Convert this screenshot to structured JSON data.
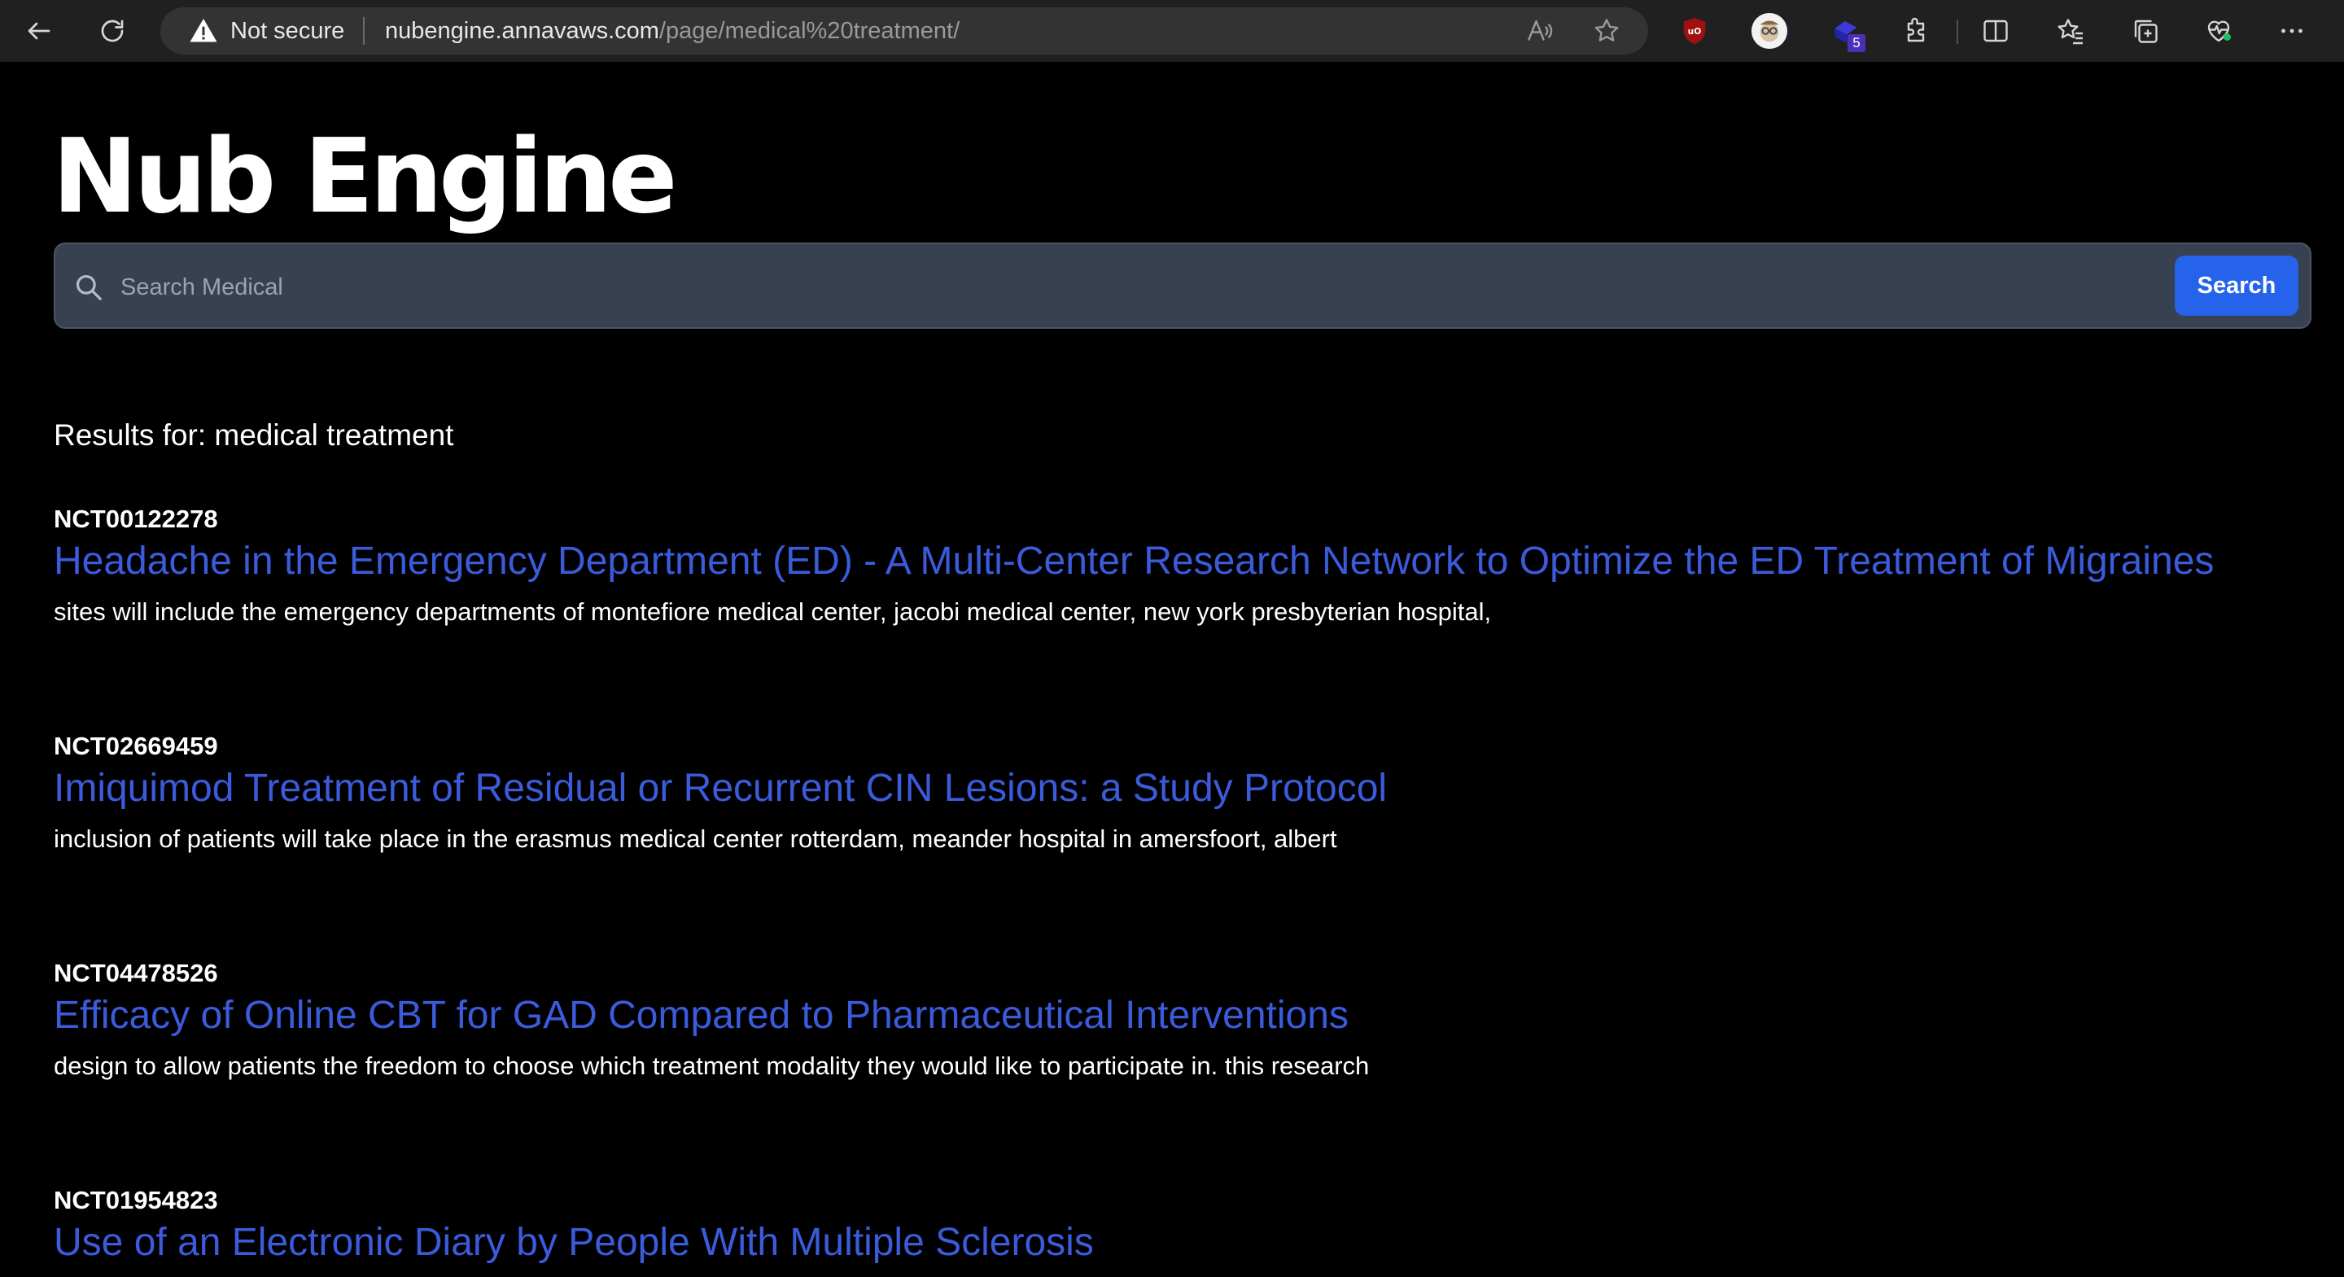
{
  "browser": {
    "security_label": "Not secure",
    "url_host": "nubengine.annavaws.com",
    "url_path": "/page/medical%20treatment/",
    "extension_badge": "5"
  },
  "site": {
    "title": "Nub Engine"
  },
  "search": {
    "placeholder": "Search Medical",
    "value": "",
    "button_label": "Search"
  },
  "results_heading": "Results for: medical treatment",
  "results": [
    {
      "id": "NCT00122278",
      "title": "Headache in the Emergency Department (ED) - A Multi-Center Research Network to Optimize the ED Treatment of Migraines",
      "snippet": "sites will include the emergency departments of montefiore medical center, jacobi medical center, new york presbyterian hospital,"
    },
    {
      "id": "NCT02669459",
      "title": "Imiquimod Treatment of Residual or Recurrent CIN Lesions: a Study Protocol",
      "snippet": "inclusion of patients will take place in the erasmus medical center rotterdam, meander hospital in amersfoort, albert"
    },
    {
      "id": "NCT04478526",
      "title": "Efficacy of Online CBT for GAD Compared to Pharmaceutical Interventions",
      "snippet": "design to allow patients the freedom to choose which treatment modality they would like to participate in. this research"
    },
    {
      "id": "NCT01954823",
      "title": "Use of an Electronic Diary by People With Multiple Sclerosis",
      "snippet": ""
    }
  ],
  "colors": {
    "page_background": "#000000",
    "link": "#3b5bdb",
    "search_button": "#2563eb",
    "search_box": "#374151"
  }
}
